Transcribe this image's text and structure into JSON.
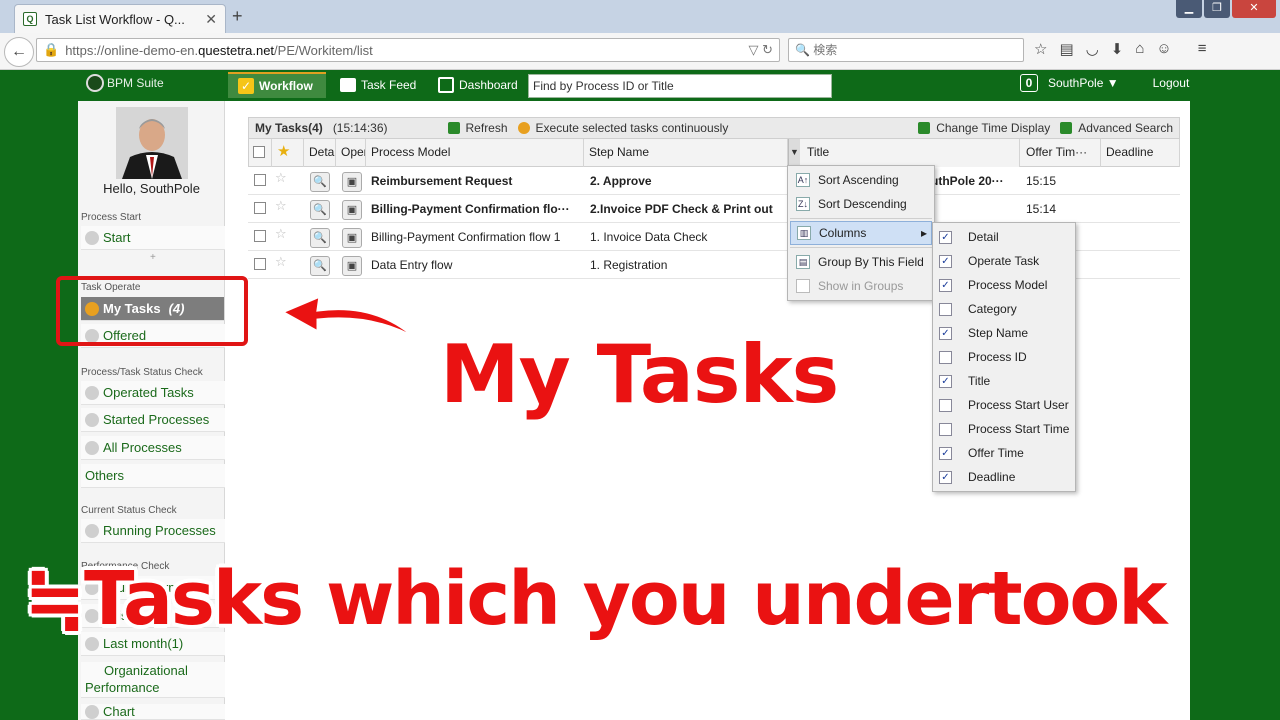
{
  "browser": {
    "tab_title": "Task List Workflow - Q...",
    "url_prefix": "https://online-demo-en.",
    "url_domain": "questetra.net",
    "url_path": "/PE/Workitem/list",
    "search_placeholder": "検索"
  },
  "app": {
    "logo_text": "BPM Suite",
    "nav": [
      "Workflow",
      "Task Feed",
      "Dashboard"
    ],
    "find_placeholder": "Find by Process ID or Title",
    "notif_count": "0",
    "user_menu": "SouthPole ▼",
    "logout": "Logout"
  },
  "sidebar": {
    "hello": "Hello, SouthPole",
    "process_start_label": "Process Start",
    "start": "Start",
    "task_operate_label": "Task Operate",
    "my_tasks": "My Tasks",
    "my_tasks_count": "(4)",
    "offered": "Offered",
    "status_check_label": "Process/Task Status Check",
    "operated_tasks": "Operated Tasks",
    "started_processes": "Started Processes",
    "all_processes": "All Processes",
    "others": "Others",
    "current_status_label": "Current Status Check",
    "running_processes": "Running Processes",
    "performance_label": "Performance Check",
    "your_performance": "Your Performance",
    "this_month": "This Month",
    "last_month": "Last month(1)",
    "org_performance_1": "Organizational",
    "org_performance_2": "Performance",
    "chart": "Chart"
  },
  "toolbar": {
    "title": "My Tasks(4)",
    "time": "(15:14:36)",
    "refresh": "Refresh",
    "execute": "Execute selected tasks continuously",
    "change_time": "Change Time Display",
    "advanced_search": "Advanced Search"
  },
  "columns": {
    "detail": "Deta",
    "operate": "Oper",
    "process_model": "Process Model",
    "step_name": "Step Name",
    "title": "Title",
    "offer_time": "Offer Tim···",
    "deadline": "Deadline"
  },
  "rows": [
    {
      "process_model": "Reimbursement Request",
      "step": "2. Approve",
      "title": "uthPole 20···",
      "offer": "15:15",
      "bold": true
    },
    {
      "process_model": "Billing-Payment Confirmation flo···",
      "step": "2.Invoice PDF Check & Print out",
      "title": "",
      "offer": "15:14",
      "bold": true
    },
    {
      "process_model": "Billing-Payment Confirmation flow 1",
      "step": "1. Invoice Data Check",
      "title": "",
      "offer": "",
      "bold": false
    },
    {
      "process_model": "Data Entry flow",
      "step": "1. Registration",
      "title": "",
      "offer": "",
      "bold": false
    }
  ],
  "context_menu": {
    "sort_asc": "Sort Ascending",
    "sort_desc": "Sort Descending",
    "columns": "Columns",
    "group_by": "Group By This Field",
    "show_groups": "Show in Groups"
  },
  "column_menu": [
    {
      "label": "Detail",
      "checked": true
    },
    {
      "label": "Operate Task",
      "checked": true
    },
    {
      "label": "Process Model",
      "checked": true
    },
    {
      "label": "Category",
      "checked": false
    },
    {
      "label": "Step Name",
      "checked": true
    },
    {
      "label": "Process ID",
      "checked": false
    },
    {
      "label": "Title",
      "checked": true
    },
    {
      "label": "Process Start User",
      "checked": false
    },
    {
      "label": "Process Start Time",
      "checked": false
    },
    {
      "label": "Offer Time",
      "checked": true
    },
    {
      "label": "Deadline",
      "checked": true
    }
  ],
  "annotation": {
    "headline": "My Tasks",
    "subline": "≒Tasks which you undertook"
  },
  "colors": {
    "accent_green": "#0e6a18",
    "annotation_red": "#ea1212"
  }
}
